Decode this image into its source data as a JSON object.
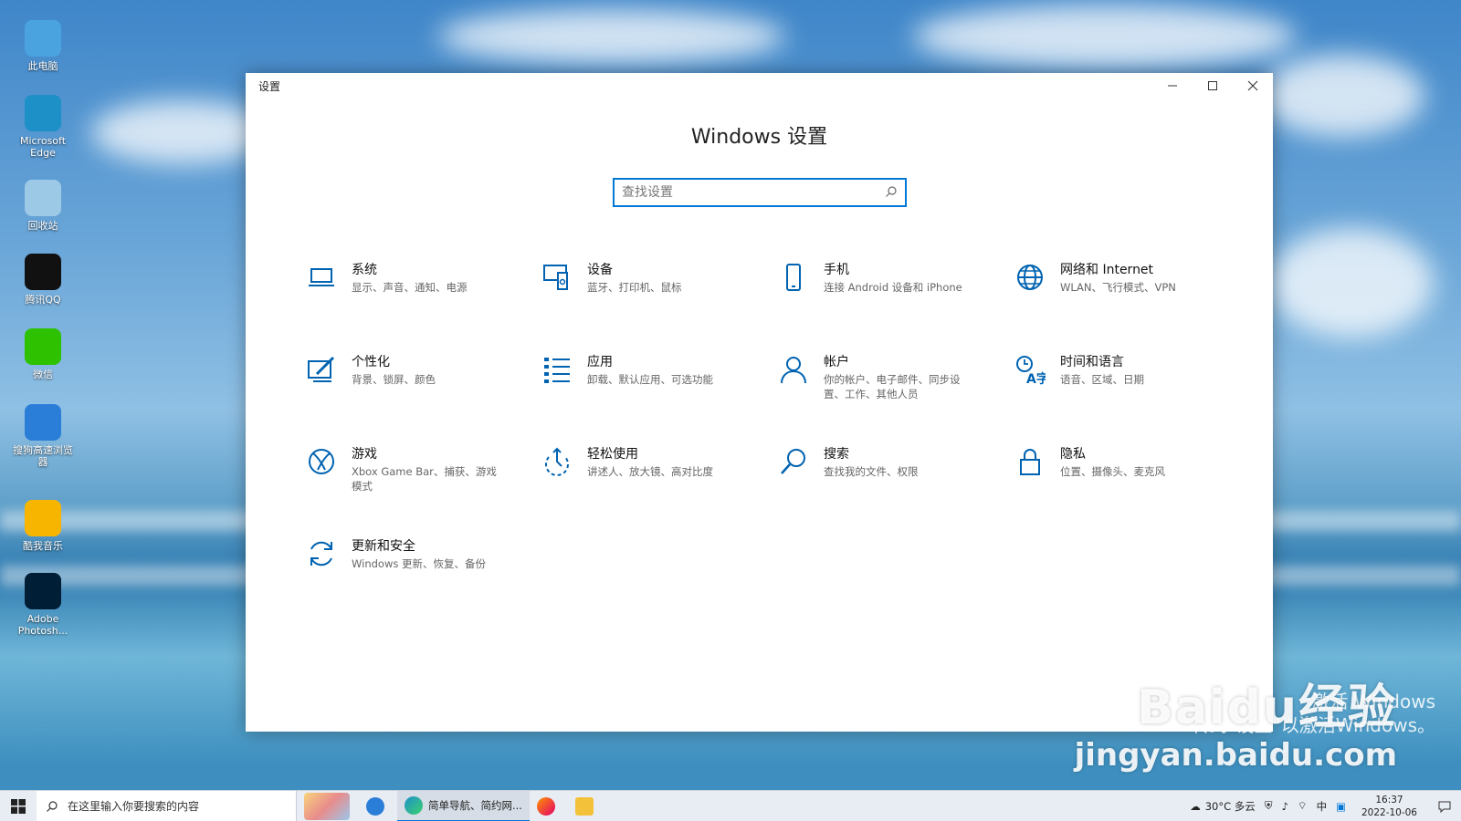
{
  "desktop": {
    "icons": [
      {
        "label": "此电脑",
        "icon": "computer-icon",
        "color": "#4aa3df"
      },
      {
        "label": "Microsoft Edge",
        "icon": "edge-icon",
        "color": "#1e90c8"
      },
      {
        "label": "回收站",
        "icon": "recycle-bin-icon",
        "color": "#9cc9e6"
      },
      {
        "label": "腾讯QQ",
        "icon": "qq-icon",
        "color": "#111111"
      },
      {
        "label": "微信",
        "icon": "wechat-icon",
        "color": "#2dc100"
      },
      {
        "label": "搜狗高速浏览器",
        "icon": "sogou-browser-icon",
        "color": "#2a7ed8"
      },
      {
        "label": "酷我音乐",
        "icon": "kuwo-music-icon",
        "color": "#f7b500"
      },
      {
        "label": "Adobe Photosh...",
        "icon": "photoshop-icon",
        "color": "#001e36"
      }
    ]
  },
  "window": {
    "title": "设置",
    "controls": {
      "minimize": "minimize-icon",
      "maximize": "maximize-icon",
      "close": "close-icon"
    }
  },
  "main": {
    "heading": "Windows 设置",
    "search": {
      "placeholder": "查找设置",
      "value": ""
    },
    "tiles": [
      {
        "name": "系统",
        "desc": "显示、声音、通知、电源",
        "icon": "laptop-icon"
      },
      {
        "name": "设备",
        "desc": "蓝牙、打印机、鼠标",
        "icon": "devices-icon"
      },
      {
        "name": "手机",
        "desc": "连接 Android 设备和 iPhone",
        "icon": "phone-icon"
      },
      {
        "name": "网络和 Internet",
        "desc": "WLAN、飞行模式、VPN",
        "icon": "globe-icon"
      },
      {
        "name": "个性化",
        "desc": "背景、锁屏、颜色",
        "icon": "personalization-icon"
      },
      {
        "name": "应用",
        "desc": "卸载、默认应用、可选功能",
        "icon": "apps-list-icon"
      },
      {
        "name": "帐户",
        "desc": "你的帐户、电子邮件、同步设置、工作、其他人员",
        "icon": "person-icon"
      },
      {
        "name": "时间和语言",
        "desc": "语音、区域、日期",
        "icon": "time-language-icon"
      },
      {
        "name": "游戏",
        "desc": "Xbox Game Bar、捕获、游戏模式",
        "icon": "xbox-icon"
      },
      {
        "name": "轻松使用",
        "desc": "讲述人、放大镜、高对比度",
        "icon": "ease-of-access-icon"
      },
      {
        "name": "搜索",
        "desc": "查找我的文件、权限",
        "icon": "search-icon"
      },
      {
        "name": "隐私",
        "desc": "位置、摄像头、麦克风",
        "icon": "lock-icon"
      },
      {
        "name": "更新和安全",
        "desc": "Windows 更新、恢复、备份",
        "icon": "update-icon"
      }
    ]
  },
  "taskbar": {
    "search_placeholder": "在这里输入你要搜索的内容",
    "apps": [
      {
        "label": "",
        "icon": "sogou-browser-icon"
      },
      {
        "label": "简单导航、简约网...",
        "icon": "edge-icon"
      },
      {
        "label": "",
        "icon": "firefox-icon"
      },
      {
        "label": "",
        "icon": "file-explorer-icon"
      }
    ],
    "weather": "30°C 多云",
    "ime": "中",
    "time": "16:37",
    "date": "2022-10-06"
  },
  "watermark": {
    "logo": "Baidu经验",
    "url": "jingyan.baidu.com",
    "activate_line1": "激活 Windows",
    "activate_line2": "转到\"设置\"以激活Windows。"
  },
  "colors": {
    "accent": "#0078d7",
    "icon_blue": "#0063b1"
  }
}
